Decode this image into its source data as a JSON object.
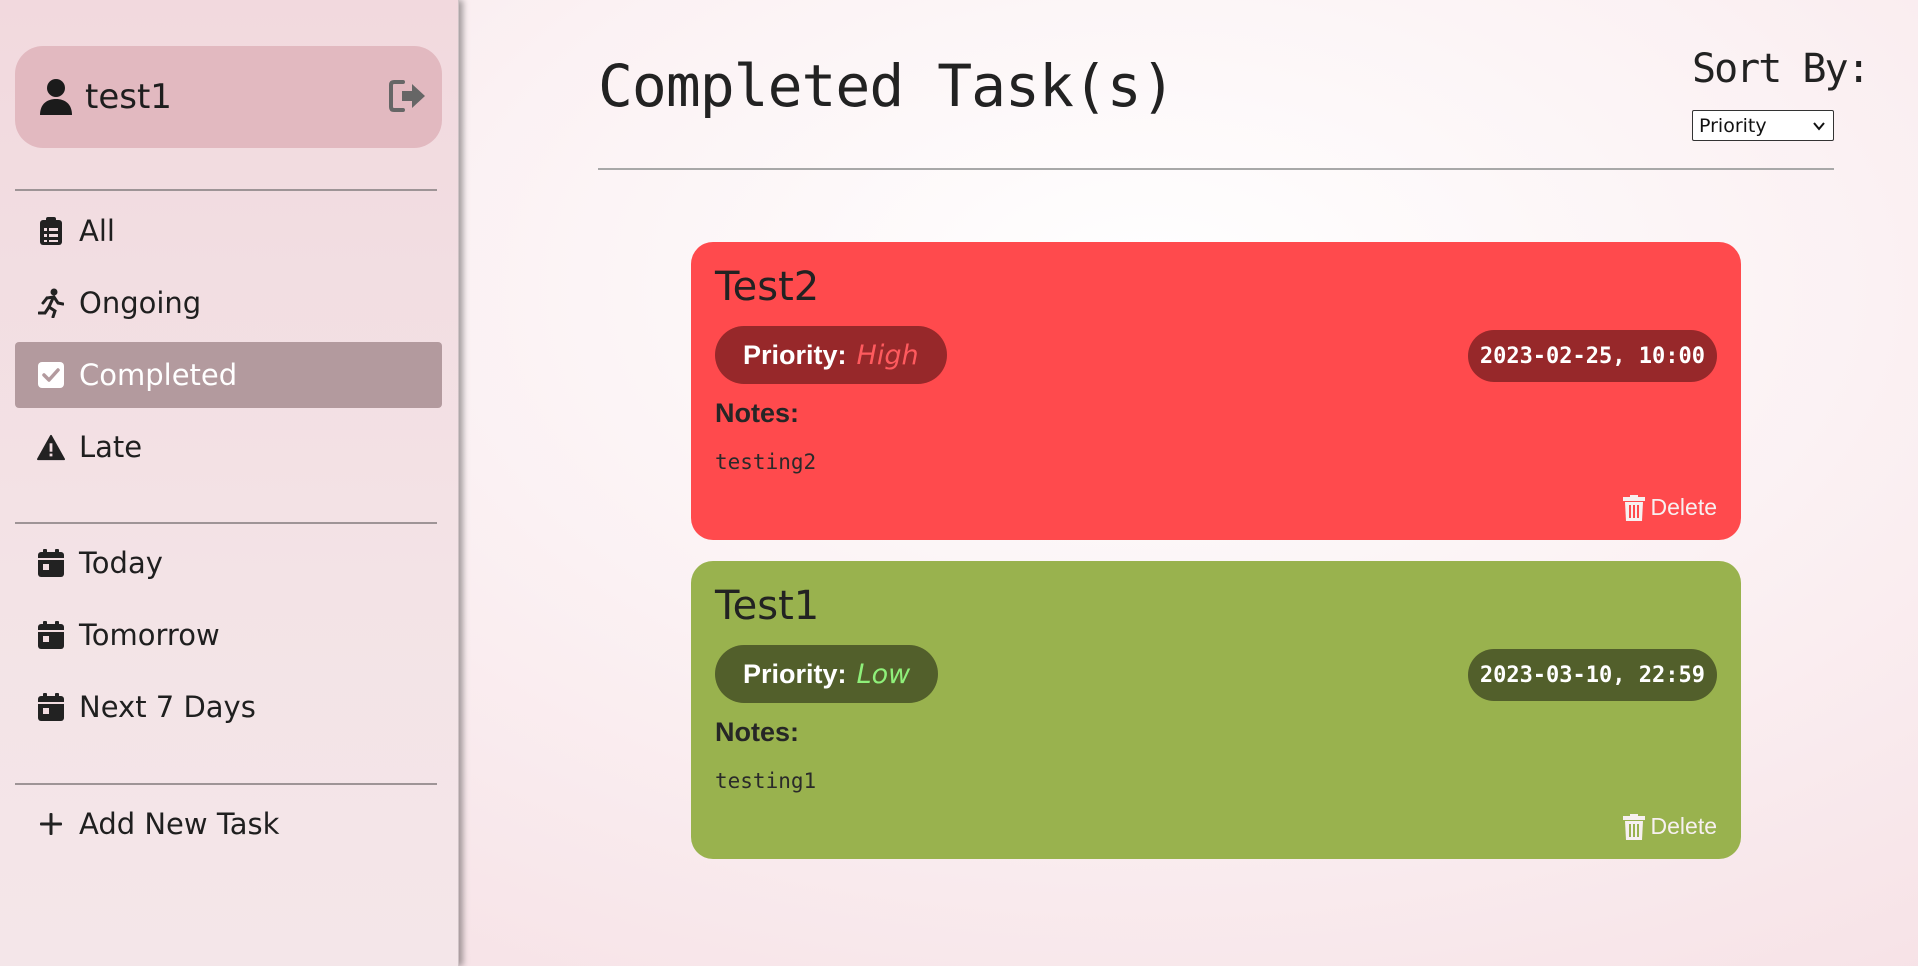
{
  "sidebar": {
    "user": {
      "name": "test1",
      "icon": "user-icon",
      "logout_icon": "logout-icon"
    },
    "status_items": [
      {
        "label": "All",
        "icon": "clipboard-list-icon"
      },
      {
        "label": "Ongoing",
        "icon": "running-person-icon"
      },
      {
        "label": "Completed",
        "icon": "check-square-icon",
        "active": true
      },
      {
        "label": "Late",
        "icon": "warning-icon"
      }
    ],
    "date_items": [
      {
        "label": "Today",
        "icon": "calendar-icon"
      },
      {
        "label": "Tomorrow",
        "icon": "calendar-icon"
      },
      {
        "label": "Next 7 Days",
        "icon": "calendar-icon"
      }
    ],
    "add_task": {
      "label": "Add New Task",
      "icon": "plus-icon"
    }
  },
  "main": {
    "title": "Completed Task(s)",
    "sort": {
      "label": "Sort By:",
      "selected": "Priority"
    },
    "tasks": [
      {
        "title": "Test2",
        "priority_label": "Priority:",
        "priority_value": "High",
        "datetime": "2023-02-25, 10:00",
        "notes_label": "Notes:",
        "notes": "testing2",
        "delete_label": "Delete",
        "color": "#ff4a4d",
        "pill_color": "#97282a",
        "priority_color": "#ff5a5e"
      },
      {
        "title": "Test1",
        "priority_label": "Priority:",
        "priority_value": "Low",
        "datetime": "2023-03-10, 22:59",
        "notes_label": "Notes:",
        "notes": "testing1",
        "delete_label": "Delete",
        "color": "#99b24e",
        "pill_color": "#525f2b",
        "priority_color": "#8ff07a"
      }
    ]
  },
  "colors": {
    "sidebar_active": "#b39a9e",
    "user_card": "#e2b9c0"
  }
}
